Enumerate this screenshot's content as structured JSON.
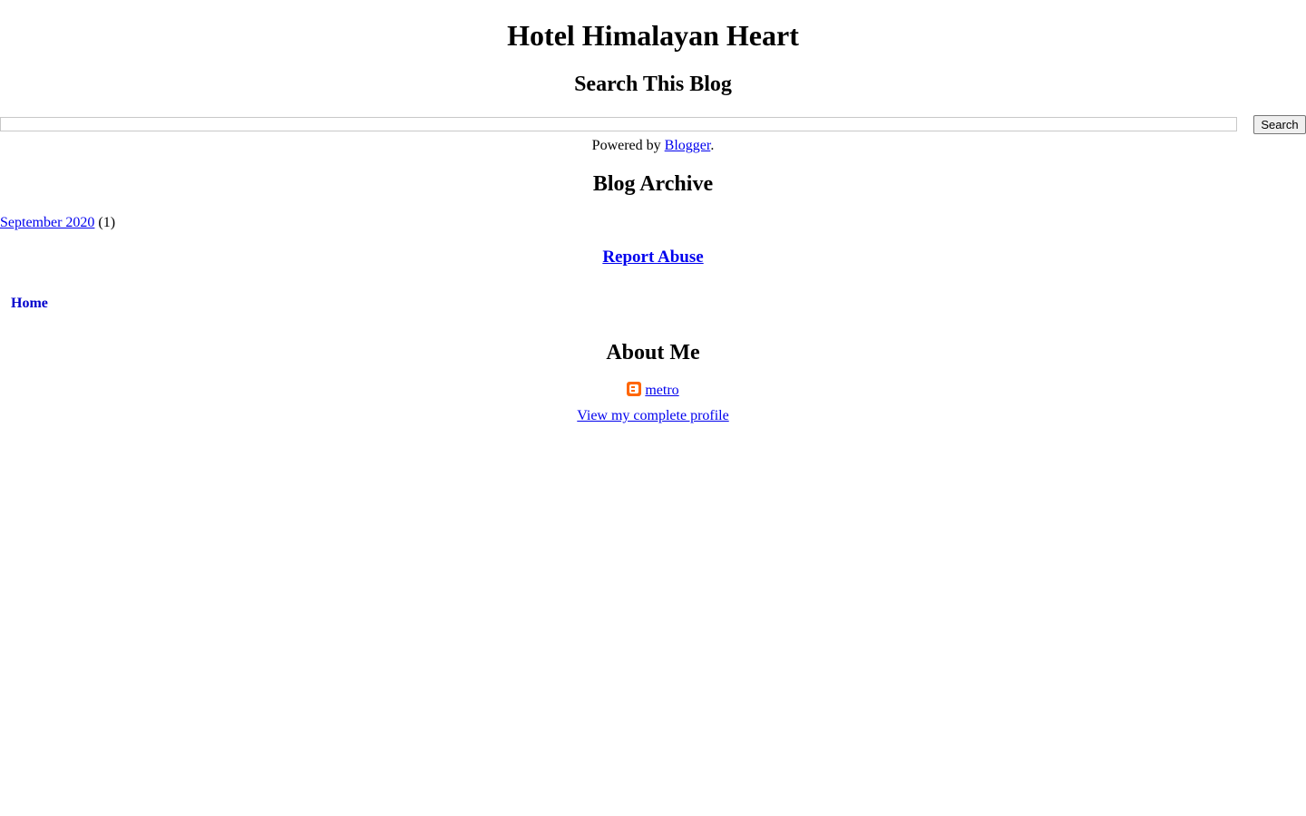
{
  "blog": {
    "title": "Hotel Himalayan Heart"
  },
  "search": {
    "heading": "Search This Blog",
    "input_value": "",
    "button_label": "Search"
  },
  "powered_by": {
    "prefix": "Powered by ",
    "link_text": "Blogger",
    "suffix": "."
  },
  "archive": {
    "heading": "Blog Archive",
    "items": [
      {
        "label": "September 2020",
        "count": "(1)"
      }
    ]
  },
  "report_abuse": {
    "label": "Report Abuse"
  },
  "nav": {
    "home_label": "Home"
  },
  "about": {
    "heading": "About Me",
    "profile_name": "metro",
    "profile_icon": "blogger-icon",
    "view_profile_label": "View my complete profile"
  },
  "colors": {
    "link": "#0000ee",
    "home_link": "#0000cc",
    "blogger_orange": "#ff6600"
  }
}
